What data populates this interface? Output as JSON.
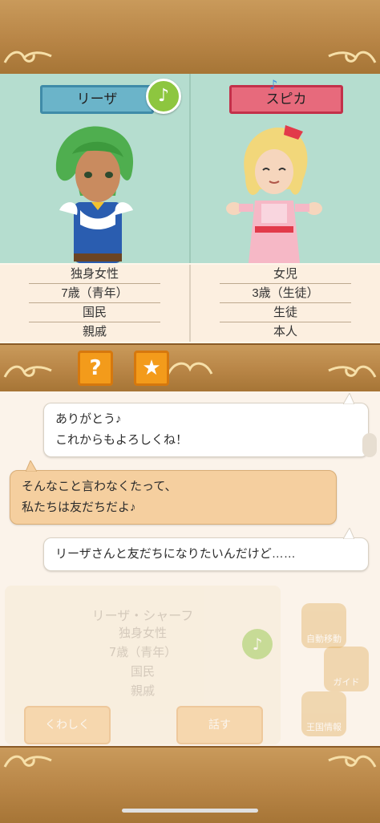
{
  "characters": {
    "left": {
      "name": "リーザ",
      "rows": [
        "独身女性",
        "7歳（青年）",
        "国民",
        "親戚"
      ]
    },
    "right": {
      "name": "スピカ",
      "rows": [
        "女児",
        "3歳（生徒）",
        "生徒",
        "本人"
      ]
    }
  },
  "badges": {
    "music_note": "♪"
  },
  "action_buttons": {
    "help": "?",
    "favorite": "★"
  },
  "chat": [
    {
      "speaker": "right",
      "lines": [
        "ありがとう♪",
        "これからもよろしくね！"
      ]
    },
    {
      "speaker": "left",
      "lines": [
        "そんなこと言わなくたって、",
        "私たちは友だちだよ♪"
      ]
    },
    {
      "speaker": "right",
      "lines": [
        "リーザさんと友だちになりたいんだけど……"
      ]
    }
  ],
  "background_panel": {
    "name": "リーザ・シャーフ",
    "rows": [
      "独身女性",
      "7歳（青年）",
      "国民",
      "親戚"
    ],
    "details_button": "くわしく",
    "talk_button": "話す",
    "menu": [
      "自動移動",
      "ガイド",
      "王国情報"
    ]
  },
  "colors": {
    "wood": "#b88546",
    "panel_bg": "#b5ddcf",
    "name_blue": "#6bb4c9",
    "name_red": "#e76a7c",
    "accent_orange": "#f39b1b",
    "note_green": "#8dc63f"
  }
}
